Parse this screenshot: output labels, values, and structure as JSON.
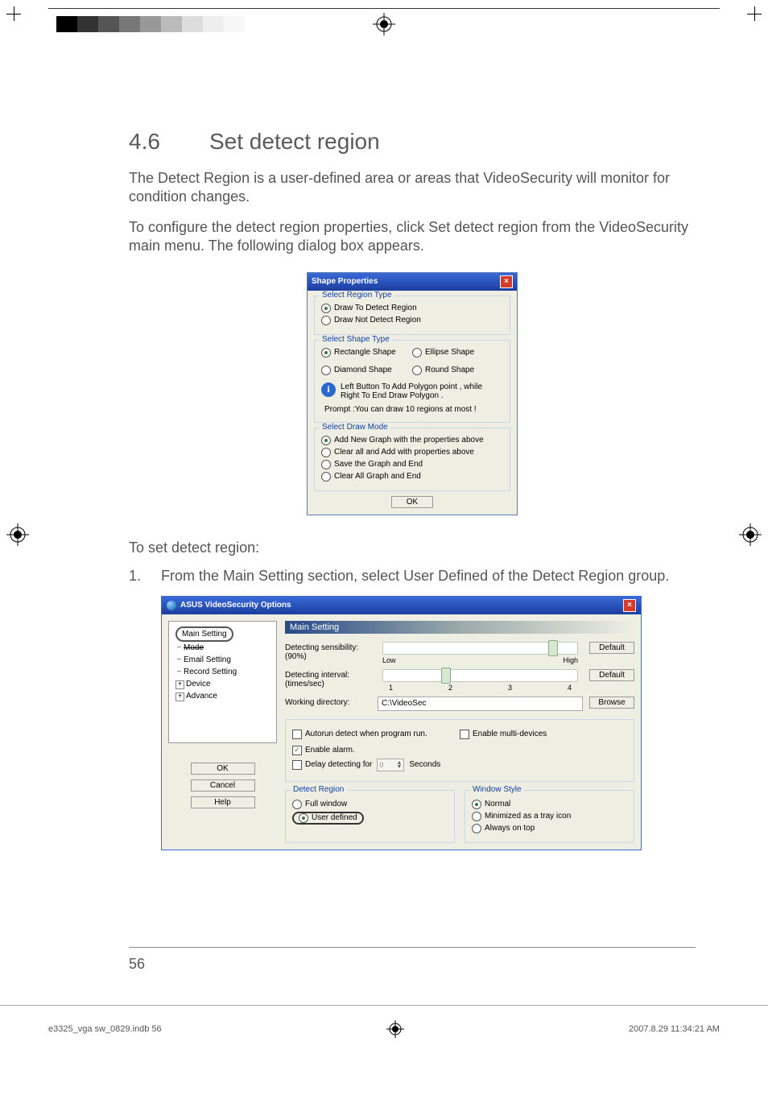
{
  "heading": {
    "number": "4.6",
    "title": "Set detect region"
  },
  "para1": "The Detect Region is a user-defined area or areas that VideoSecurity will monitor for condition changes.",
  "para2": "To configure the detect region properties, click Set detect region from the VideoSecurity main menu. The following dialog box appears.",
  "step_intro": "To set detect region:",
  "step1_num": "1.",
  "step1_text": "From the Main Setting section, select User Defined of the Detect Region group.",
  "page_number": "56",
  "footer": {
    "left": "e3325_vga sw_0829.indb   56",
    "right": "2007.8.29   11:34:21 AM"
  },
  "dlg1": {
    "title": "Shape Properties",
    "region_type": {
      "legend": "Select Region Type",
      "opt1": "Draw To  Detect Region",
      "opt2": "Draw Not Detect Region"
    },
    "shape_type": {
      "legend": "Select Shape Type",
      "rect": "Rectangle Shape",
      "ellipse": "Ellipse Shape",
      "diamond": "Diamond Shape",
      "round": "Round Shape",
      "info": "Left  Button To Add Polygon point , while Right To End Draw Polygon .",
      "prompt": "Prompt :You can draw 10 regions at most !"
    },
    "draw_mode": {
      "legend": "Select Draw Mode",
      "o1": "Add New Graph with the properties above",
      "o2": "Clear all and Add with properties above",
      "o3": "Save the Graph and End",
      "o4": "Clear All Graph and End"
    },
    "ok": "OK"
  },
  "dlg2": {
    "title": "ASUS VideoSecurity Options",
    "tree": {
      "main": "Main Setting",
      "mode": "Mode",
      "email": "Email Setting",
      "record": "Record Setting",
      "device": "Device",
      "advance": "Advance"
    },
    "left_btns": {
      "ok": "OK",
      "cancel": "Cancel",
      "help": "Help"
    },
    "panel_title": "Main Setting",
    "sensibility": {
      "label": "Detecting sensibility:",
      "value": "(90%)",
      "low": "Low",
      "high": "High",
      "default": "Default"
    },
    "interval": {
      "label": "Detecting interval:",
      "unit": "(times/sec)",
      "t1": "1",
      "t2": "2",
      "t3": "3",
      "t4": "4",
      "default": "Default"
    },
    "workdir": {
      "label": "Working directory:",
      "value": "C:\\VideoSec",
      "browse": "Browse"
    },
    "opts": {
      "autorun": "Autorun detect when program run.",
      "multi": "Enable multi-devices",
      "alarm": "Enable alarm.",
      "delay": "Delay detecting for",
      "delay_val": "0",
      "seconds": "Seconds"
    },
    "detect_region": {
      "legend": "Detect Region",
      "full": "Full window",
      "user": "User defined"
    },
    "window_style": {
      "legend": "Window Style",
      "normal": "Normal",
      "tray": "Minimized as a tray icon",
      "top": "Always on top"
    }
  }
}
